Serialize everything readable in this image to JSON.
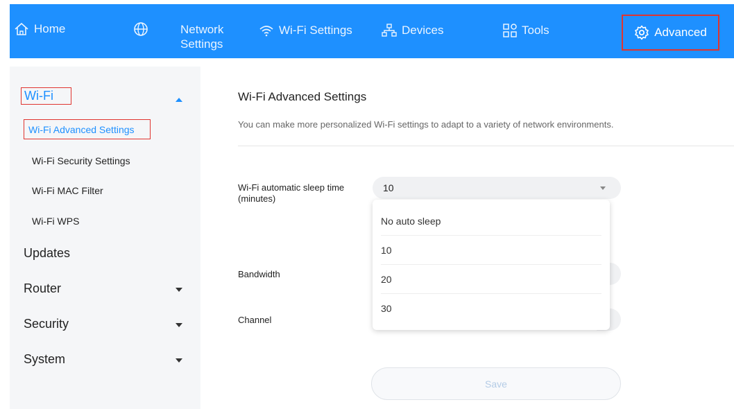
{
  "nav": {
    "home": "Home",
    "network_line1": "Network",
    "network_line2": "Settings",
    "wifi_settings": "Wi-Fi Settings",
    "devices": "Devices",
    "tools": "Tools",
    "advanced": "Advanced"
  },
  "sidebar": {
    "wifi": "Wi-Fi",
    "wifi_items": [
      "Wi-Fi Advanced Settings",
      "Wi-Fi Security Settings",
      "Wi-Fi MAC Filter",
      "Wi-Fi WPS"
    ],
    "updates": "Updates",
    "router": "Router",
    "security": "Security",
    "system": "System"
  },
  "main": {
    "title": "Wi-Fi Advanced Settings",
    "description": "You can make more personalized Wi-Fi settings to adapt to a variety of network environments.",
    "sleep_label_line1": "Wi-Fi automatic sleep time",
    "sleep_label_line2": "(minutes)",
    "sleep_value": "10",
    "sleep_options": [
      "No auto sleep",
      "10",
      "20",
      "30"
    ],
    "bandwidth_label": "Bandwidth",
    "channel_label": "Channel",
    "save": "Save"
  },
  "colors": {
    "accent": "#1e90ff",
    "highlight_border": "#e0342f"
  }
}
